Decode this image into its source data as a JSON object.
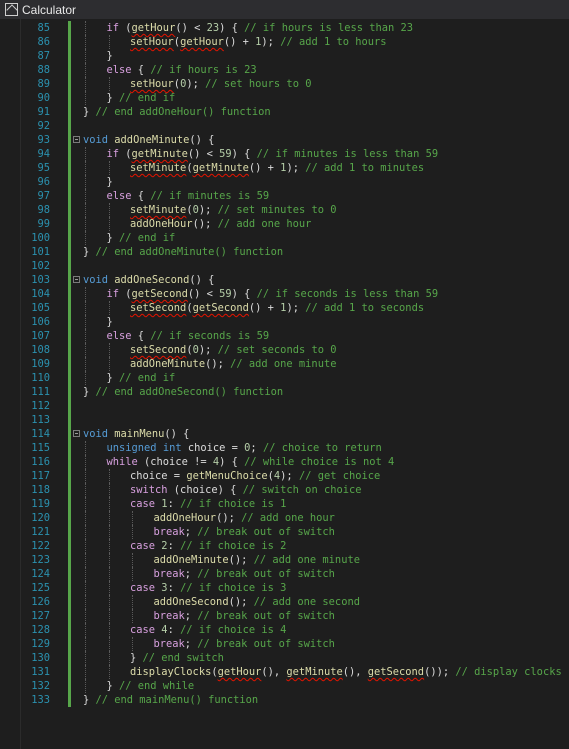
{
  "window": {
    "title": "Calculator",
    "icon": "calculator-app-icon"
  },
  "colors": {
    "keyword": "#569cd6",
    "control": "#d8a0df",
    "function": "#dcdcaa",
    "comment": "#57a64a",
    "line_number": "#2b91af",
    "modified_bar": "#57a64a"
  },
  "lines": [
    {
      "n": "85",
      "fold": "",
      "ind": 1,
      "t": [
        [
          "if",
          "ctl"
        ],
        [
          " ("
        ],
        [
          "getHour",
          "fn err"
        ],
        [
          "() < "
        ],
        [
          "23",
          "num"
        ],
        [
          ") { "
        ],
        [
          "// if hours is less than 23",
          "cm"
        ]
      ]
    },
    {
      "n": "86",
      "fold": "",
      "ind": 2,
      "t": [
        [
          "setHour",
          "fn err"
        ],
        [
          "("
        ],
        [
          "getHour",
          "fn err"
        ],
        [
          "() + "
        ],
        [
          "1",
          "num"
        ],
        [
          "); "
        ],
        [
          "// add 1 to hours",
          "cm"
        ]
      ]
    },
    {
      "n": "87",
      "fold": "",
      "ind": 1,
      "t": [
        [
          "}"
        ]
      ]
    },
    {
      "n": "88",
      "fold": "",
      "ind": 1,
      "t": [
        [
          "else",
          "ctl"
        ],
        [
          " { "
        ],
        [
          "// if hours is 23",
          "cm"
        ]
      ]
    },
    {
      "n": "89",
      "fold": "",
      "ind": 2,
      "t": [
        [
          "setHour",
          "fn err"
        ],
        [
          "("
        ],
        [
          "0",
          "num"
        ],
        [
          "); "
        ],
        [
          "// set hours to 0",
          "cm"
        ]
      ]
    },
    {
      "n": "90",
      "fold": "",
      "ind": 1,
      "t": [
        [
          "} "
        ],
        [
          "// end if",
          "cm"
        ]
      ]
    },
    {
      "n": "91",
      "fold": "",
      "ind": 0,
      "t": [
        [
          "} "
        ],
        [
          "// end addOneHour() function",
          "cm"
        ]
      ]
    },
    {
      "n": "92",
      "fold": "",
      "ind": 0,
      "t": []
    },
    {
      "n": "93",
      "fold": "box",
      "ind": 0,
      "t": [
        [
          "void",
          "kw"
        ],
        [
          " "
        ],
        [
          "addOneMinute",
          "fn"
        ],
        [
          "() {"
        ]
      ]
    },
    {
      "n": "94",
      "fold": "",
      "ind": 1,
      "t": [
        [
          "if",
          "ctl"
        ],
        [
          " ("
        ],
        [
          "getMinute",
          "fn err"
        ],
        [
          "() < "
        ],
        [
          "59",
          "num"
        ],
        [
          ") { "
        ],
        [
          "// if minutes is less than 59",
          "cm"
        ]
      ]
    },
    {
      "n": "95",
      "fold": "",
      "ind": 2,
      "t": [
        [
          "setMinute",
          "fn err"
        ],
        [
          "("
        ],
        [
          "getMinute",
          "fn err"
        ],
        [
          "() + "
        ],
        [
          "1",
          "num"
        ],
        [
          "); "
        ],
        [
          "// add 1 to minutes",
          "cm"
        ]
      ]
    },
    {
      "n": "96",
      "fold": "",
      "ind": 1,
      "t": [
        [
          "}"
        ]
      ]
    },
    {
      "n": "97",
      "fold": "",
      "ind": 1,
      "t": [
        [
          "else",
          "ctl"
        ],
        [
          " { "
        ],
        [
          "// if minutes is 59",
          "cm"
        ]
      ]
    },
    {
      "n": "98",
      "fold": "",
      "ind": 2,
      "t": [
        [
          "setMinute",
          "fn err"
        ],
        [
          "("
        ],
        [
          "0",
          "num"
        ],
        [
          "); "
        ],
        [
          "// set minutes to 0",
          "cm"
        ]
      ]
    },
    {
      "n": "99",
      "fold": "",
      "ind": 2,
      "t": [
        [
          "addOneHour",
          "fn"
        ],
        [
          "(); "
        ],
        [
          "// add one hour",
          "cm"
        ]
      ]
    },
    {
      "n": "100",
      "fold": "",
      "ind": 1,
      "t": [
        [
          "} "
        ],
        [
          "// end if",
          "cm"
        ]
      ]
    },
    {
      "n": "101",
      "fold": "",
      "ind": 0,
      "t": [
        [
          "} "
        ],
        [
          "// end addOneMinute() function",
          "cm"
        ]
      ]
    },
    {
      "n": "102",
      "fold": "",
      "ind": 0,
      "t": []
    },
    {
      "n": "103",
      "fold": "box",
      "ind": 0,
      "t": [
        [
          "void",
          "kw"
        ],
        [
          " "
        ],
        [
          "addOneSecond",
          "fn"
        ],
        [
          "() {"
        ]
      ]
    },
    {
      "n": "104",
      "fold": "",
      "ind": 1,
      "t": [
        [
          "if",
          "ctl"
        ],
        [
          " ("
        ],
        [
          "getSecond",
          "fn err"
        ],
        [
          "() < "
        ],
        [
          "59",
          "num"
        ],
        [
          ") { "
        ],
        [
          "// if seconds is less than 59",
          "cm"
        ]
      ]
    },
    {
      "n": "105",
      "fold": "",
      "ind": 2,
      "t": [
        [
          "setSecond",
          "fn err"
        ],
        [
          "("
        ],
        [
          "getSecond",
          "fn err"
        ],
        [
          "() + "
        ],
        [
          "1",
          "num"
        ],
        [
          "); "
        ],
        [
          "// add 1 to seconds",
          "cm"
        ]
      ]
    },
    {
      "n": "106",
      "fold": "",
      "ind": 1,
      "t": [
        [
          "}"
        ]
      ]
    },
    {
      "n": "107",
      "fold": "",
      "ind": 1,
      "t": [
        [
          "else",
          "ctl"
        ],
        [
          " { "
        ],
        [
          "// if seconds is 59",
          "cm"
        ]
      ]
    },
    {
      "n": "108",
      "fold": "",
      "ind": 2,
      "t": [
        [
          "setSecond",
          "fn err"
        ],
        [
          "("
        ],
        [
          "0",
          "num"
        ],
        [
          "); "
        ],
        [
          "// set seconds to 0",
          "cm"
        ]
      ]
    },
    {
      "n": "109",
      "fold": "",
      "ind": 2,
      "t": [
        [
          "addOneMinute",
          "fn"
        ],
        [
          "(); "
        ],
        [
          "// add one minute",
          "cm"
        ]
      ]
    },
    {
      "n": "110",
      "fold": "",
      "ind": 1,
      "t": [
        [
          "} "
        ],
        [
          "// end if",
          "cm"
        ]
      ]
    },
    {
      "n": "111",
      "fold": "",
      "ind": 0,
      "t": [
        [
          "} "
        ],
        [
          "// end addOneSecond() function",
          "cm"
        ]
      ]
    },
    {
      "n": "112",
      "fold": "",
      "ind": 0,
      "t": []
    },
    {
      "n": "113",
      "fold": "",
      "ind": 0,
      "t": []
    },
    {
      "n": "114",
      "fold": "box",
      "ind": 0,
      "t": [
        [
          "void",
          "kw"
        ],
        [
          " "
        ],
        [
          "mainMenu",
          "fn"
        ],
        [
          "() {"
        ]
      ]
    },
    {
      "n": "115",
      "fold": "",
      "ind": 1,
      "t": [
        [
          "unsigned",
          "kw"
        ],
        [
          " "
        ],
        [
          "int",
          "kw"
        ],
        [
          " choice = "
        ],
        [
          "0",
          "num"
        ],
        [
          "; "
        ],
        [
          "// choice to return",
          "cm"
        ]
      ]
    },
    {
      "n": "116",
      "fold": "",
      "ind": 1,
      "t": [
        [
          "while",
          "ctl"
        ],
        [
          " (choice != "
        ],
        [
          "4",
          "num"
        ],
        [
          ") { "
        ],
        [
          "// while choice is not 4",
          "cm"
        ]
      ]
    },
    {
      "n": "117",
      "fold": "",
      "ind": 2,
      "t": [
        [
          "choice = "
        ],
        [
          "getMenuChoice",
          "fn"
        ],
        [
          "("
        ],
        [
          "4",
          "num"
        ],
        [
          "); "
        ],
        [
          "// get choice",
          "cm"
        ]
      ]
    },
    {
      "n": "118",
      "fold": "",
      "ind": 2,
      "t": [
        [
          "switch",
          "ctl"
        ],
        [
          " (choice) { "
        ],
        [
          "// switch on choice",
          "cm"
        ]
      ]
    },
    {
      "n": "119",
      "fold": "",
      "ind": 2,
      "t": [
        [
          "case",
          "ctl"
        ],
        [
          " "
        ],
        [
          "1",
          "num"
        ],
        [
          ": "
        ],
        [
          "// if choice is 1",
          "cm"
        ]
      ]
    },
    {
      "n": "120",
      "fold": "",
      "ind": 3,
      "t": [
        [
          "addOneHour",
          "fn"
        ],
        [
          "(); "
        ],
        [
          "// add one hour",
          "cm"
        ]
      ]
    },
    {
      "n": "121",
      "fold": "",
      "ind": 3,
      "t": [
        [
          "break",
          "ctl"
        ],
        [
          "; "
        ],
        [
          "// break out of switch",
          "cm"
        ]
      ]
    },
    {
      "n": "122",
      "fold": "",
      "ind": 2,
      "t": [
        [
          "case",
          "ctl"
        ],
        [
          " "
        ],
        [
          "2",
          "num"
        ],
        [
          ": "
        ],
        [
          "// if choice is 2",
          "cm"
        ]
      ]
    },
    {
      "n": "123",
      "fold": "",
      "ind": 3,
      "t": [
        [
          "addOneMinute",
          "fn"
        ],
        [
          "(); "
        ],
        [
          "// add one minute",
          "cm"
        ]
      ]
    },
    {
      "n": "124",
      "fold": "",
      "ind": 3,
      "t": [
        [
          "break",
          "ctl"
        ],
        [
          "; "
        ],
        [
          "// break out of switch",
          "cm"
        ]
      ]
    },
    {
      "n": "125",
      "fold": "",
      "ind": 2,
      "t": [
        [
          "case",
          "ctl"
        ],
        [
          " "
        ],
        [
          "3",
          "num"
        ],
        [
          ": "
        ],
        [
          "// if choice is 3",
          "cm"
        ]
      ]
    },
    {
      "n": "126",
      "fold": "",
      "ind": 3,
      "t": [
        [
          "addOneSecond",
          "fn"
        ],
        [
          "(); "
        ],
        [
          "// add one second",
          "cm"
        ]
      ]
    },
    {
      "n": "127",
      "fold": "",
      "ind": 3,
      "t": [
        [
          "break",
          "ctl"
        ],
        [
          "; "
        ],
        [
          "// break out of switch",
          "cm"
        ]
      ]
    },
    {
      "n": "128",
      "fold": "",
      "ind": 2,
      "t": [
        [
          "case",
          "ctl"
        ],
        [
          " "
        ],
        [
          "4",
          "num"
        ],
        [
          ": "
        ],
        [
          "// if choice is 4",
          "cm"
        ]
      ]
    },
    {
      "n": "129",
      "fold": "",
      "ind": 3,
      "t": [
        [
          "break",
          "ctl"
        ],
        [
          "; "
        ],
        [
          "// break out of switch",
          "cm"
        ]
      ]
    },
    {
      "n": "130",
      "fold": "",
      "ind": 2,
      "t": [
        [
          "} "
        ],
        [
          "// end switch",
          "cm"
        ]
      ]
    },
    {
      "n": "131",
      "fold": "",
      "ind": 2,
      "t": [
        [
          "displayClocks",
          "fn"
        ],
        [
          "("
        ],
        [
          "getHour",
          "fn err"
        ],
        [
          "(), "
        ],
        [
          "getMinute",
          "fn err"
        ],
        [
          "(), "
        ],
        [
          "getSecond",
          "fn err"
        ],
        [
          "()); "
        ],
        [
          "// display clocks",
          "cm"
        ]
      ]
    },
    {
      "n": "132",
      "fold": "",
      "ind": 1,
      "t": [
        [
          "} "
        ],
        [
          "// end while",
          "cm"
        ]
      ]
    },
    {
      "n": "133",
      "fold": "",
      "ind": 0,
      "t": [
        [
          "} "
        ],
        [
          "// end mainMenu() function",
          "cm"
        ]
      ]
    }
  ]
}
